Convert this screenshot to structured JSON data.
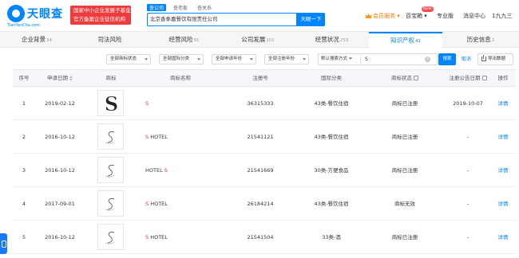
{
  "header": {
    "logo_name": "天眼查",
    "logo_url": "TianYanCha.com",
    "promo_text": "国家中小企业发展子基金旗下\n官方备案企业征信机构",
    "search_tabs": [
      "查公司",
      "查老板",
      "查关系"
    ],
    "search_value": "北京香季嘉餐饮有限责任公司",
    "search_button": "天眼一下",
    "nav": {
      "vip": "会员服务",
      "box": "百宝箱",
      "box_badge": "NEW",
      "edition": "专业版",
      "messages": "消息中心",
      "user": "1九九三"
    }
  },
  "tabs": [
    {
      "label": "企业背景",
      "count": "34"
    },
    {
      "label": "司法风险",
      "count": ""
    },
    {
      "label": "经营风险",
      "count": "91"
    },
    {
      "label": "公司发展",
      "count": "101"
    },
    {
      "label": "经营状况",
      "count": "253"
    },
    {
      "label": "知识产权",
      "count": "41"
    },
    {
      "label": "历史信息",
      "count": "3"
    }
  ],
  "filters": {
    "dropdowns": [
      "全部商标状态",
      "全部国际分类",
      "全部申请年份",
      "全部注册年份"
    ],
    "search_mode": "默认搜索方式",
    "search_value": "S",
    "search_button": "搜索",
    "cancel": "取消",
    "export": "导出数据"
  },
  "table": {
    "headers": [
      "序号",
      "申请日期",
      "商标",
      "商标名称",
      "注册号",
      "国际分类",
      "商标状态",
      "注册公告日期",
      "操作"
    ],
    "rows": [
      {
        "no": "1",
        "date": "2019-02-12",
        "name_prefix": "",
        "name_hl": "S",
        "name_suffix": "",
        "reg": "36315333",
        "cls": "43类-餐饮住宿",
        "status": "商标已注册",
        "pub": "2019-10-07",
        "op": "详情"
      },
      {
        "no": "2",
        "date": "2016-10-12",
        "name_prefix": "",
        "name_hl": "S",
        "name_suffix": " HOTEL",
        "reg": "21541121",
        "cls": "43类-餐饮住宿",
        "status": "商标已注册",
        "pub": "-",
        "op": "详情"
      },
      {
        "no": "3",
        "date": "2016-10-12",
        "name_prefix": "HOTEL ",
        "name_hl": "S",
        "name_suffix": "",
        "reg": "21541669",
        "cls": "30类-方便食品",
        "status": "商标已注册",
        "pub": "-",
        "op": "详情"
      },
      {
        "no": "4",
        "date": "2017-09-01",
        "name_prefix": "",
        "name_hl": "S",
        "name_suffix": " HOTEL",
        "reg": "26184214",
        "cls": "43类-餐饮住宿",
        "status": "商标无效",
        "pub": "-",
        "op": "详情"
      },
      {
        "no": "5",
        "date": "2016-10-12",
        "name_prefix": "",
        "name_hl": "S",
        "name_suffix": " HOTEL",
        "reg": "21541504",
        "cls": "33类-酒",
        "status": "商标已注册",
        "pub": "-",
        "op": "详情"
      }
    ]
  },
  "colors": {
    "brand": "#0084ff",
    "highlight": "#e33333",
    "vip": "#ff7a00"
  }
}
